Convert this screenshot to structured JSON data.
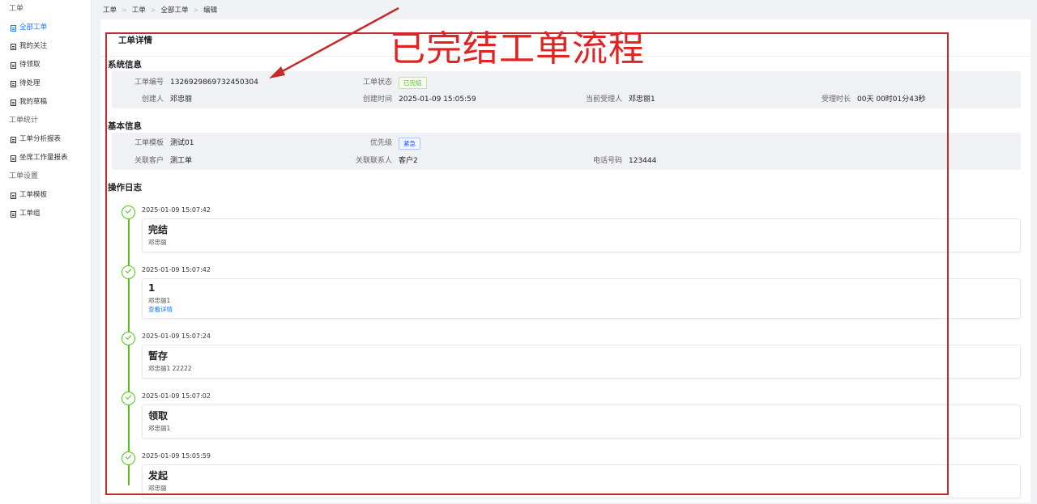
{
  "sidebar": {
    "groups": [
      {
        "label": "工单",
        "items": [
          {
            "label": "全部工单",
            "active": true
          },
          {
            "label": "我的关注"
          },
          {
            "label": "待领取"
          },
          {
            "label": "待处理"
          },
          {
            "label": "我的草稿"
          }
        ]
      },
      {
        "label": "工单统计",
        "items": [
          {
            "label": "工单分析报表"
          },
          {
            "label": "坐席工作量报表"
          }
        ]
      },
      {
        "label": "工单设置",
        "items": [
          {
            "label": "工单模板"
          },
          {
            "label": "工单组"
          }
        ]
      }
    ]
  },
  "breadcrumb": [
    "工单",
    "工单",
    "全部工单",
    "编辑"
  ],
  "panel": {
    "title": "工单详情"
  },
  "system_info": {
    "title": "系统信息",
    "ticket_no_label": "工单编号",
    "ticket_no": "1326929869732450304",
    "status_label": "工单状态",
    "status": "已完结",
    "creator_label": "创建人",
    "creator": "邓忠丽",
    "created_label": "创建时间",
    "created": "2025-01-09 15:05:59",
    "assignee_label": "当前受理人",
    "assignee": "邓忠丽1",
    "duration_label": "受理时长",
    "duration": "00天 00时01分43秒"
  },
  "basic_info": {
    "title": "基本信息",
    "template_label": "工单模板",
    "template": "测试01",
    "priority_label": "优先级",
    "priority": "紧急",
    "customer_label": "关联客户",
    "customer": "测工单",
    "contact_label": "关联联系人",
    "contact": "客户2",
    "phone_label": "电话号码",
    "phone": "123444"
  },
  "log": {
    "title": "操作日志",
    "entries": [
      {
        "time": "2025-01-09 15:07:42",
        "title": "完结",
        "desc": "邓忠丽"
      },
      {
        "time": "2025-01-09 15:07:42",
        "title": "1",
        "desc": "邓忠丽1",
        "link": "查看详情"
      },
      {
        "time": "2025-01-09 15:07:24",
        "title": "暂存",
        "desc": "邓忠丽1 22222"
      },
      {
        "time": "2025-01-09 15:07:02",
        "title": "领取",
        "desc": "邓忠丽1"
      },
      {
        "time": "2025-01-09 15:05:59",
        "title": "发起",
        "desc": "邓忠丽"
      }
    ]
  },
  "annotation": {
    "text": "已完结工单流程",
    "color": "#e02424"
  },
  "colors": {
    "accent": "#1677ff",
    "success": "#52c41a",
    "annotation_red": "#c52b2b"
  }
}
